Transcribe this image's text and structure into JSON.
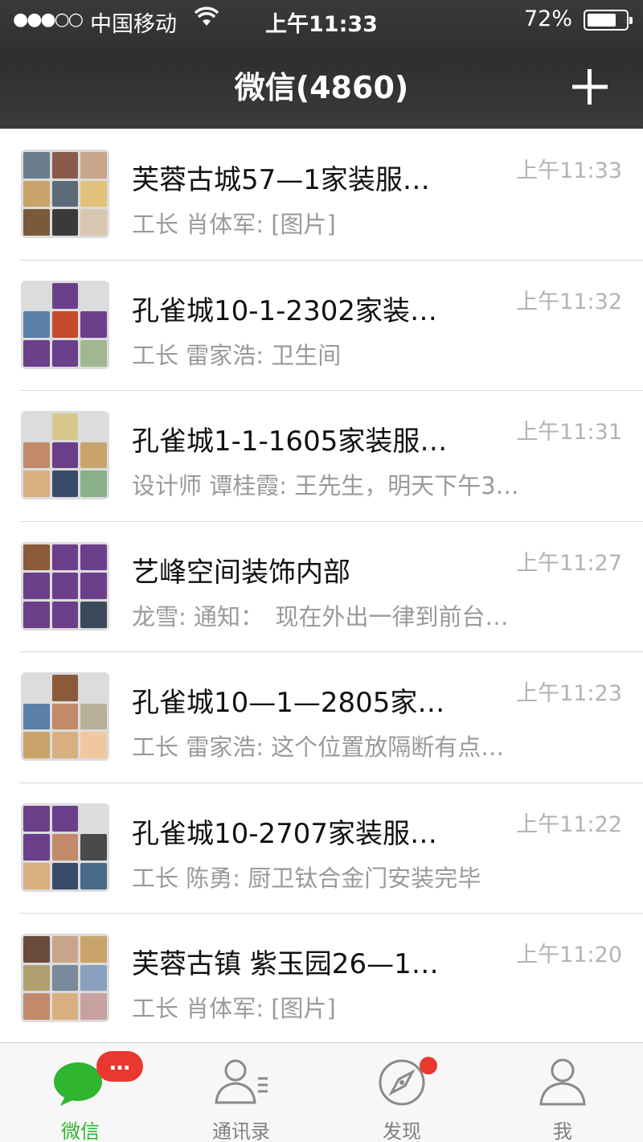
{
  "status_bar": {
    "signal": "●●●○○",
    "carrier": "中国移动",
    "time": "上午11:33",
    "battery": "72%",
    "battery_level": 0.72
  },
  "header": {
    "title": "微信(4860)"
  },
  "chats": [
    {
      "name": "芙蓉古城57—1家装服…",
      "time": "上午11:33",
      "preview": "工长 肖体军: [图片]",
      "tiles": [
        "#6a7d8c",
        "#8a5b4a",
        "#c9a58c",
        "#c9a46a",
        "#5b6b7a",
        "#e2c27a",
        "#7a5a3a",
        "#3a3a3a",
        "#d8c7b0"
      ]
    },
    {
      "name": "孔雀城10-1-2302家装…",
      "time": "上午11:32",
      "preview": "工长 雷家浩: 卫生间",
      "tiles": [
        "empty",
        "#6b3f8a",
        "empty",
        "#5a7fa8",
        "#c44a2c",
        "#6b3f8a",
        "#6b3f8a",
        "#6b3f8a",
        "#a0b890"
      ]
    },
    {
      "name": "孔雀城1-1-1605家装服…",
      "time": "上午11:31",
      "preview": "设计师 谭桂霞: 王先生，明天下午3…",
      "tiles": [
        "empty",
        "#d8c78a",
        "empty",
        "#c28a6a",
        "#6b3f8a",
        "#c9a46a",
        "#d8b080",
        "#3a4a6a",
        "#8ab08a"
      ]
    },
    {
      "name": "艺峰空间装饰内部",
      "time": "上午11:27",
      "preview": "龙雪: 通知：　现在外出一律到前台…",
      "tiles": [
        "#8a5a3a",
        "#6b3f8a",
        "#6b3f8a",
        "#6b3f8a",
        "#6b3f8a",
        "#6b3f8a",
        "#6b3f8a",
        "#6b3f8a",
        "#3a4a5a"
      ]
    },
    {
      "name": "孔雀城10—1—2805家…",
      "time": "上午11:23",
      "preview": "工长 雷家浩: 这个位置放隔断有点…",
      "tiles": [
        "empty",
        "#8a5a3a",
        "empty",
        "#5a7fa8",
        "#c28a6a",
        "#b8b09a",
        "#c9a46a",
        "#d8b080",
        "#f0c8a0"
      ]
    },
    {
      "name": "孔雀城10-2707家装服…",
      "time": "上午11:22",
      "preview": "工长 陈勇: 厨卫钛合金门安装完毕",
      "tiles": [
        "#6b3f8a",
        "#6b3f8a",
        "empty",
        "#6b3f8a",
        "#c28a6a",
        "#4a4a4a",
        "#d8b080",
        "#3a4a6a",
        "#4a6a8a"
      ]
    },
    {
      "name": "芙蓉古镇 紫玉园26—1…",
      "time": "上午11:20",
      "preview": "工长 肖体军: [图片]",
      "tiles": [
        "#6a4a3a",
        "#c9a58c",
        "#c9a46a",
        "#b0a070",
        "#7a8a9a",
        "#8aa0c0",
        "#c28a6a",
        "#d8b080",
        "#c9a0a0"
      ]
    }
  ],
  "tabs": [
    {
      "label": "微信",
      "icon": "chat-bubble-icon",
      "badge": "…"
    },
    {
      "label": "通讯录",
      "icon": "contacts-icon"
    },
    {
      "label": "发现",
      "icon": "compass-icon"
    },
    {
      "label": "我",
      "icon": "person-icon"
    }
  ],
  "colors": {
    "accent_green": "#2fb52f",
    "badge_red": "#e8382f",
    "header_bg": "#363638"
  }
}
